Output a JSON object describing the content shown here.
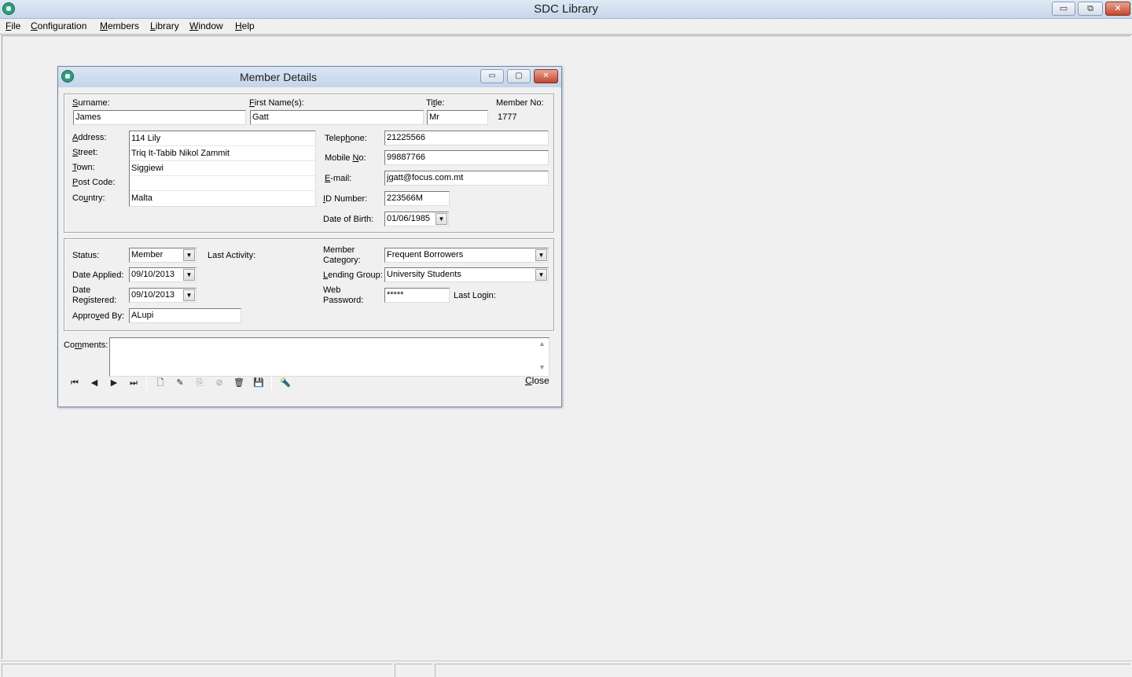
{
  "app": {
    "title": "SDC Library",
    "window_buttons": {
      "minimize": "▭",
      "restore": "⧉",
      "close": "✕"
    }
  },
  "menu": [
    {
      "label": "File",
      "accel": "F",
      "rest": "ile"
    },
    {
      "label": "Configuration",
      "accel": "C",
      "rest": "onfiguration"
    },
    {
      "label": "Members",
      "accel": "M",
      "rest": "embers"
    },
    {
      "label": "Library",
      "accel": "L",
      "rest": "ibrary"
    },
    {
      "label": "Window",
      "accel": "W",
      "rest": "indow"
    },
    {
      "label": "Help",
      "accel": "H",
      "rest": "elp"
    }
  ],
  "dialog": {
    "title": "Member Details",
    "window_buttons": {
      "minimize": "▭",
      "restore": "▢",
      "close": "✕"
    },
    "labels": {
      "surname": {
        "pre": "",
        "ul": "S",
        "post": "urname:"
      },
      "first_name": {
        "pre": "",
        "ul": "F",
        "post": "irst Name(s):"
      },
      "title": {
        "pre": "Ti",
        "ul": "t",
        "post": "le:"
      },
      "member_no": "Member No:",
      "address": {
        "pre": "",
        "ul": "A",
        "post": "ddress:"
      },
      "street": {
        "pre": "",
        "ul": "S",
        "post": "treet:"
      },
      "town": {
        "pre": "",
        "ul": "T",
        "post": "own:"
      },
      "post_code": {
        "pre": "",
        "ul": "P",
        "post": "ost Code:"
      },
      "country": {
        "pre": "Co",
        "ul": "u",
        "post": "ntry:"
      },
      "telephone": {
        "pre": "Telep",
        "ul": "h",
        "post": "one:"
      },
      "mobile": {
        "pre": "Mobile ",
        "ul": "N",
        "post": "o:"
      },
      "email": {
        "pre": "",
        "ul": "E",
        "post": "-mail:"
      },
      "id_number": {
        "pre": "",
        "ul": "I",
        "post": "D Number:"
      },
      "dob": "Date of Birth:",
      "status": "Status:",
      "last_activity": "Last Activity:",
      "member_category_1": "Member",
      "member_category_2": "Category:",
      "date_applied": "Date Applied:",
      "lending_group": {
        "pre": "",
        "ul": "L",
        "post": "ending Group:"
      },
      "date_registered_1": "Date",
      "date_registered_2": "Registered:",
      "web_password_1": "Web",
      "web_password_2": "Password:",
      "last_login": "Last Login:",
      "approved_by": {
        "pre": "Appro",
        "ul": "v",
        "post": "ed By:"
      },
      "comments": {
        "pre": "Co",
        "ul": "m",
        "post": "ments:"
      }
    },
    "values": {
      "surname": "James",
      "first_name": "Gatt",
      "title": "Mr",
      "member_no": "1777",
      "address": "114 Lily",
      "street": "Triq It-Tabib Nikol Zammit",
      "town": "Siggiewi",
      "post_code": "",
      "country": "Malta",
      "telephone": "21225566",
      "mobile": "99887766",
      "email": "jgatt@focus.com.mt",
      "id_number": "223566M",
      "dob": "01/06/1985",
      "status": "Member",
      "member_category": "Frequent Borrowers",
      "date_applied": "09/10/2013",
      "lending_group": "University Students",
      "date_registered": "09/10/2013",
      "web_password": "*****",
      "approved_by": "ALupi",
      "comments": ""
    },
    "toolbar": {
      "first": "⏮",
      "prev": "◀",
      "next": "▶",
      "last": "⏭",
      "new": "🗋",
      "edit": "✎",
      "copy": "⎘",
      "cancel": "⊘",
      "delete": "🗑",
      "save": "💾",
      "find": "🔦"
    },
    "close": {
      "pre": "",
      "ul": "C",
      "post": "lose"
    },
    "dropdown_arrow": "▼",
    "scroll_up": "▲",
    "scroll_down": "▼"
  }
}
